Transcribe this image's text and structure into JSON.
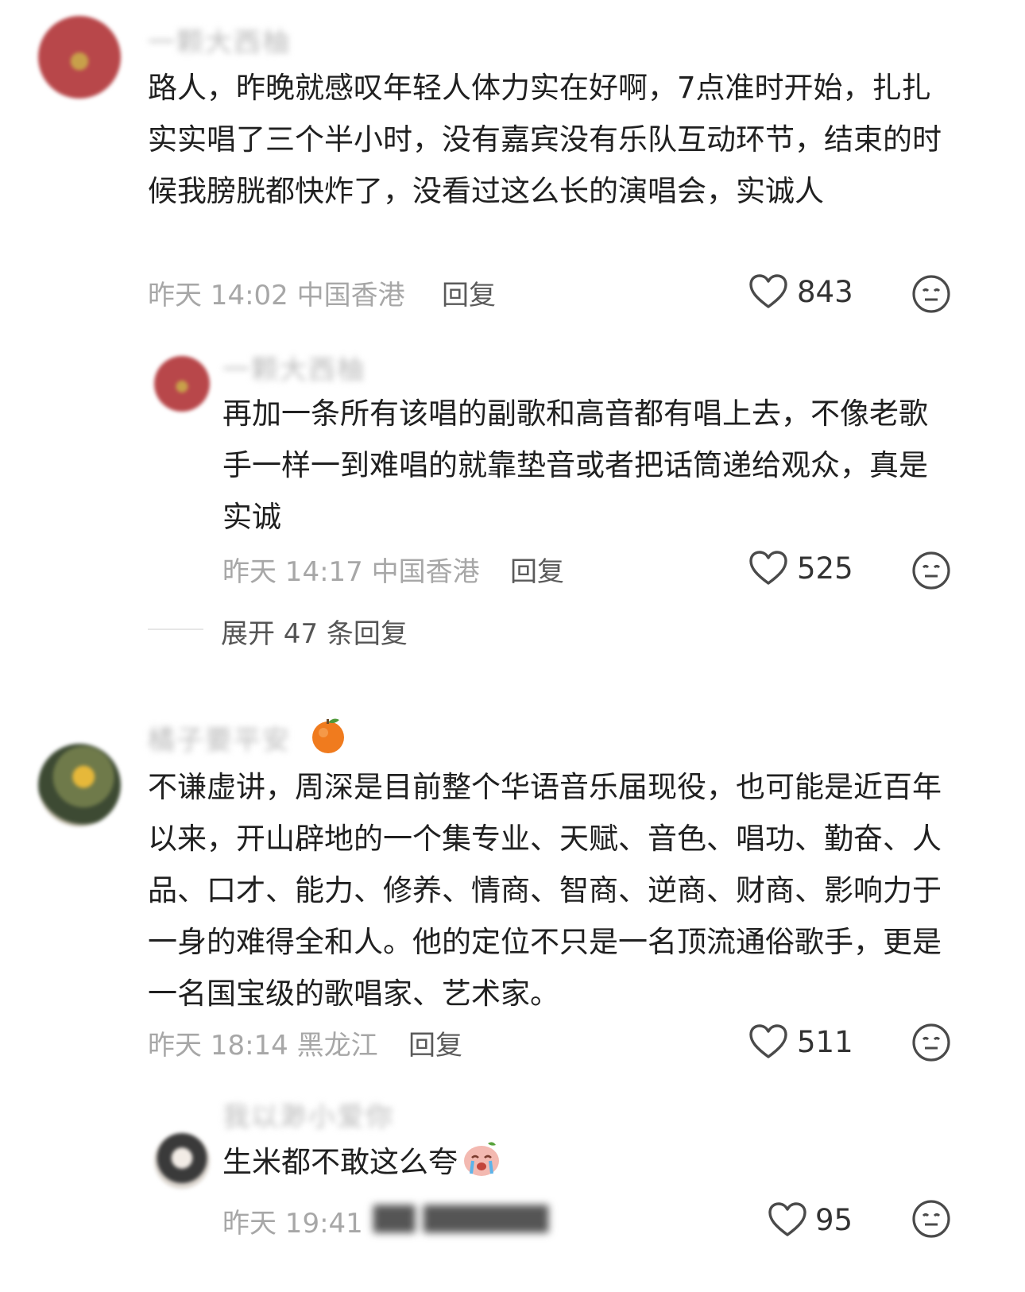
{
  "comments": [
    {
      "username": "一颗大西柚",
      "text": "路人，昨晚就感叹年轻人体力实在好啊，7点准时开始，扎扎实实唱了三个半小时，没有嘉宾没有乐队互动环节，结束的时候我膀胱都快炸了，没看过这么长的演唱会，实诚人",
      "meta": "昨天 14:02 中国香港",
      "reply_label": "回复",
      "likes": "843",
      "reply": {
        "username": "一颗大西柚",
        "text": "再加一条所有该唱的副歌和高音都有唱上去，不像老歌手一样一到难唱的就靠垫音或者把话筒递给观众，真是实诚",
        "meta": "昨天 14:17 中国香港",
        "reply_label": "回复",
        "likes": "525"
      },
      "expand_label": "展开 47 条回复"
    },
    {
      "username": "橘子要平安",
      "text": "不谦虚讲，周深是目前整个华语音乐届现役，也可能是近百年以来，开山辟地的一个集专业、天赋、音色、唱功、勤奋、人品、口才、能力、修养、情商、智商、逆商、财商、影响力于一身的难得全和人。他的定位不只是一名顶流通俗歌手，更是一名国宝级的歌唱家、艺术家。",
      "meta": "昨天 18:14 黑龙江",
      "reply_label": "回复",
      "likes": "511",
      "reply": {
        "username": "我以渺小爱你",
        "text": "生米都不敢这么夸",
        "meta": "昨天 19:41",
        "likes": "95"
      }
    }
  ],
  "icons": {
    "like": "heart-outline-icon",
    "dislike": "meh-face-icon",
    "username_emoji": "orange-emoji-icon",
    "reply_emoji": "crying-face-emoji-icon"
  },
  "colors": {
    "text": "#202020",
    "meta": "#a7a7a7",
    "icon": "#4a4a4a"
  }
}
